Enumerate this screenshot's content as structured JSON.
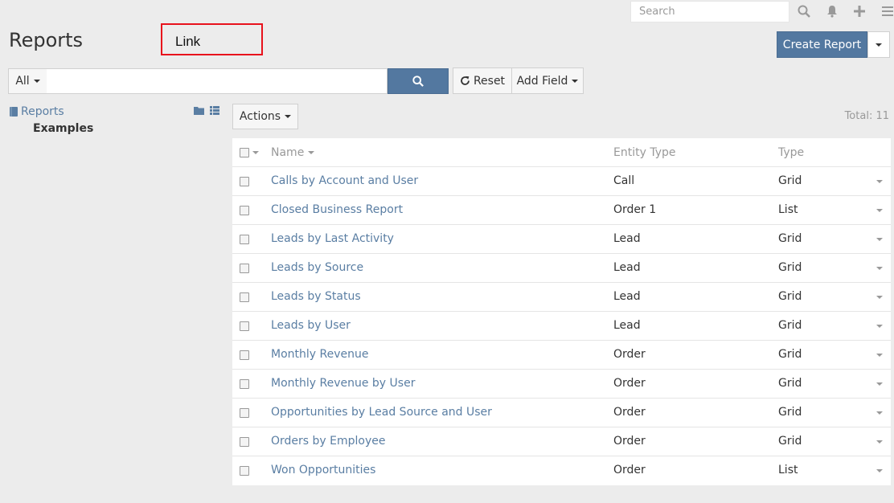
{
  "navbar": {
    "search_placeholder": "Search",
    "icons": [
      "search-icon",
      "bell-icon",
      "plus-icon",
      "menu-icon"
    ]
  },
  "page": {
    "title": "Reports",
    "annotation_label": "Link",
    "create_button": "Create Report"
  },
  "filter": {
    "scope": "All",
    "search_value": "",
    "reset_label": "Reset",
    "add_field_label": "Add Field"
  },
  "tree": {
    "root": "Reports",
    "child": "Examples"
  },
  "list": {
    "actions_label": "Actions",
    "total": "Total: 11",
    "columns": [
      "Name",
      "Entity Type",
      "Type"
    ],
    "rows": [
      {
        "name": "Calls by Account and User",
        "entity": "Call",
        "type": "Grid"
      },
      {
        "name": "Closed Business Report",
        "entity": "Order 1",
        "type": "List"
      },
      {
        "name": "Leads by Last Activity",
        "entity": "Lead",
        "type": "Grid"
      },
      {
        "name": "Leads by Source",
        "entity": "Lead",
        "type": "Grid"
      },
      {
        "name": "Leads by Status",
        "entity": "Lead",
        "type": "Grid"
      },
      {
        "name": "Leads by User",
        "entity": "Lead",
        "type": "Grid"
      },
      {
        "name": "Monthly Revenue",
        "entity": "Order",
        "type": "Grid"
      },
      {
        "name": "Monthly Revenue by User",
        "entity": "Order",
        "type": "Grid"
      },
      {
        "name": "Opportunities by Lead Source and User",
        "entity": "Order",
        "type": "Grid"
      },
      {
        "name": "Orders by Employee",
        "entity": "Order",
        "type": "Grid"
      },
      {
        "name": "Won Opportunities",
        "entity": "Order",
        "type": "List"
      }
    ]
  },
  "colors": {
    "accent": "#5378a0",
    "link": "#5a7ea3",
    "annotation": "#e8121c"
  }
}
